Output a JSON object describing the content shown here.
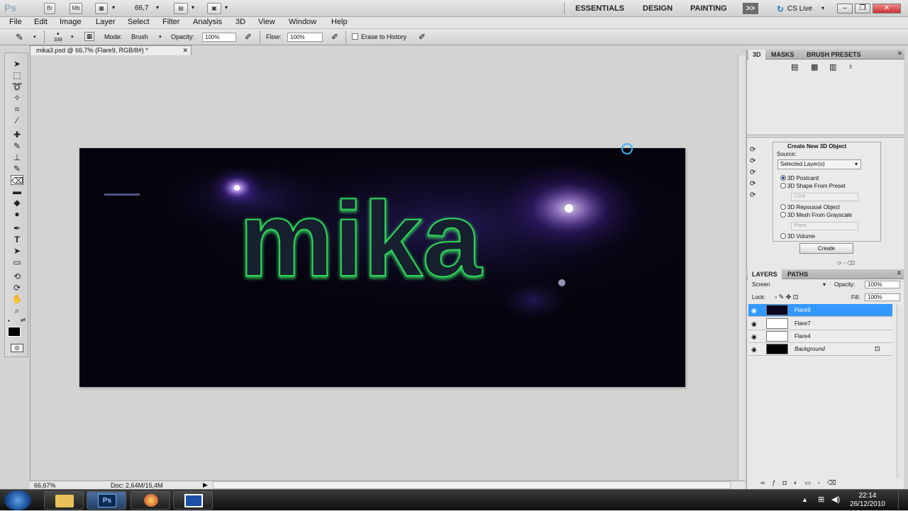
{
  "app": {
    "logo": "Ps",
    "top_buttons": [
      "Br",
      "Mb"
    ],
    "zoom_display": "66,7",
    "workspaces": [
      "ESSENTIALS",
      "DESIGN",
      "PAINTING"
    ],
    "more_label": ">>",
    "cs_live": "CS Live"
  },
  "menu": [
    "File",
    "Edit",
    "Image",
    "Layer",
    "Select",
    "Filter",
    "Analysis",
    "3D",
    "View",
    "Window",
    "Help"
  ],
  "options": {
    "brush_size": "339",
    "mode_label": "Mode:",
    "mode_value": "Brush",
    "opacity_label": "Opacity:",
    "opacity_value": "100%",
    "flow_label": "Flow:",
    "flow_value": "100%",
    "erase_history": "Erase to History"
  },
  "document": {
    "tab_title": "mika3.psd @ 66,7% (Flare9, RGB/8#) *",
    "canvas_text": "mika"
  },
  "status": {
    "zoom": "66,67%",
    "doc": "Doc: 2,64M/15,4M"
  },
  "panels": {
    "top_tabs": [
      "3D",
      "MASKS",
      "BRUSH PRESETS"
    ],
    "create3d": {
      "title": "Create New 3D Object",
      "source_label": "Source:",
      "source_value": "Selected Layer(s)",
      "options": [
        "3D Postcard",
        "3D Shape From Preset",
        "3D Repoussé Object",
        "3D Mesh From Grayscale",
        "3D Volume"
      ],
      "shape_preset": "Cone",
      "mesh_preset": "Plane",
      "create_button": "Create"
    },
    "layer_tabs": [
      "LAYERS",
      "PATHS"
    ],
    "blend_mode": "Screen",
    "opacity_label": "Opacity:",
    "opacity_value": "100%",
    "lock_label": "Lock:",
    "fill_label": "Fill:",
    "fill_value": "100%",
    "layers": [
      {
        "name": "Flare9",
        "selected": true
      },
      {
        "name": "Flare7",
        "selected": false
      },
      {
        "name": "Flare4",
        "selected": false
      },
      {
        "name": "Background",
        "selected": false
      }
    ]
  },
  "taskbar": {
    "time": "22:14",
    "date": "26/12/2010",
    "ps_label": "Ps"
  },
  "colors": {
    "selection": "#3399ff",
    "glow_green": "#3cff6a",
    "glow_purple": "#a25cff"
  }
}
